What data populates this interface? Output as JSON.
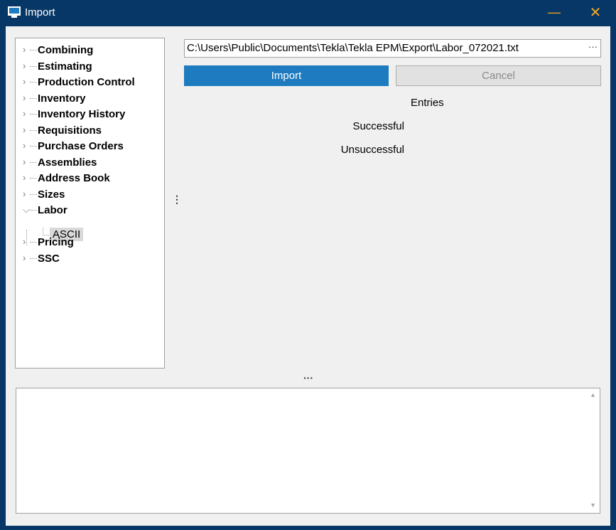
{
  "window": {
    "title": "Import",
    "minimize_glyph": "—",
    "close_glyph": "✕"
  },
  "tree": {
    "items": [
      {
        "label": "Combining",
        "expanded": false
      },
      {
        "label": "Estimating",
        "expanded": false
      },
      {
        "label": "Production Control",
        "expanded": false
      },
      {
        "label": "Inventory",
        "expanded": false
      },
      {
        "label": "Inventory History",
        "expanded": false
      },
      {
        "label": "Requisitions",
        "expanded": false
      },
      {
        "label": "Purchase Orders",
        "expanded": false
      },
      {
        "label": "Assemblies",
        "expanded": false
      },
      {
        "label": "Address Book",
        "expanded": false
      },
      {
        "label": "Sizes",
        "expanded": false
      },
      {
        "label": "Labor",
        "expanded": true
      },
      {
        "label": "Pricing",
        "expanded": false
      },
      {
        "label": "SSC",
        "expanded": false
      }
    ],
    "labor_child": "ASCII"
  },
  "file": {
    "path": "C:\\Users\\Public\\Documents\\Tekla\\Tekla EPM\\Export\\Labor_072021.txt",
    "browse_label": "···"
  },
  "buttons": {
    "import_label": "Import",
    "cancel_label": "Cancel"
  },
  "results": {
    "entries_label": "Entries",
    "successful_label": "Successful",
    "unsuccessful_label": "Unsuccessful"
  },
  "splitters": {
    "vertical_glyph": "⋮",
    "horizontal_glyph": "···"
  },
  "colors": {
    "title_bar": "#073766",
    "accent": "#1e7bbf",
    "window_controls": "#f5a623"
  }
}
